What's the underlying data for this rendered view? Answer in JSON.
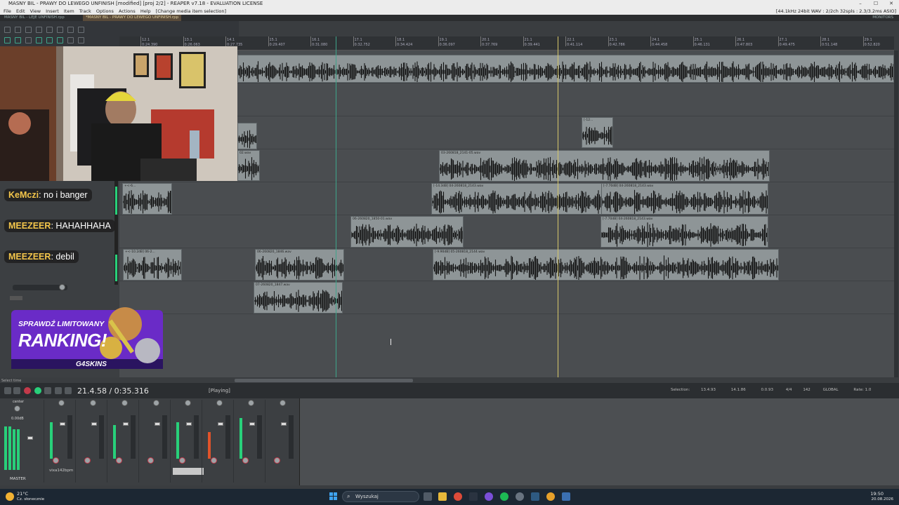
{
  "window": {
    "title": "MASNY BIL - PRAWY DO LEWEGO UNFINISH [modified] [proj 2/2] - REAPER v7.18 - EVALUATION LICENSE",
    "controls": [
      "–",
      "☐",
      "✕"
    ]
  },
  "menu": {
    "items": [
      "File",
      "Edit",
      "View",
      "Insert",
      "Item",
      "Track",
      "Options",
      "Actions",
      "Help"
    ],
    "hint": "[Change media item selection]",
    "audio_status": "[44.1kHz 24bit WAV : 2/2ch 32spls : 2.3/3.2ms ASIO]"
  },
  "tabs": [
    {
      "label": "MASNY BIL - LEJE UNFINISH.rpp"
    },
    {
      "label": "*MASNY BIL - PRAWY DO LEWEGO UNFINISH.rpp"
    }
  ],
  "monitoring": "MONITORS",
  "ruler": {
    "markers": [
      {
        "bar": "12.1",
        "time": "0:24.390"
      },
      {
        "bar": "13.1",
        "time": "0:26.063"
      },
      {
        "bar": "14.1",
        "time": "0:27.735"
      },
      {
        "bar": "15.1",
        "time": "0:29.407"
      },
      {
        "bar": "16.1",
        "time": "0:31.080"
      },
      {
        "bar": "17.1",
        "time": "0:32.752"
      },
      {
        "bar": "18.1",
        "time": "0:34.424"
      },
      {
        "bar": "19.1",
        "time": "0:36.097"
      },
      {
        "bar": "20.1",
        "time": "0:37.769"
      },
      {
        "bar": "21.1",
        "time": "0:39.441"
      },
      {
        "bar": "22.1",
        "time": "0:41.114"
      },
      {
        "bar": "23.1",
        "time": "0:42.786"
      },
      {
        "bar": "24.1",
        "time": "0:44.458"
      },
      {
        "bar": "25.1",
        "time": "0:46.131"
      },
      {
        "bar": "26.1",
        "time": "0:47.803"
      },
      {
        "bar": "27.1",
        "time": "0:49.475"
      },
      {
        "bar": "28.1",
        "time": "0:51.148"
      },
      {
        "bar": "29.1",
        "time": "0:52.820"
      }
    ]
  },
  "items": [
    {
      "label": "[-12..."
    },
    {
      "label": "02.wav"
    },
    {
      "label": "03-260818_2141-05.wav"
    },
    {
      "label": "+<-6..."
    },
    {
      "label": "[-14.3dB] 04-260818_2143.wav"
    },
    {
      "label": "[-7.70dB] 04-260818_2143.wav"
    },
    {
      "label": "06-260820_1850-01.wav"
    },
    {
      "label": "[-7.70dB] 04-260818_2143.wav"
    },
    {
      "label": "+<-10.2dB] 06-2..."
    },
    {
      "label": "06-260820_1846.wav"
    },
    {
      "label": "[-9.90dB] 05-260818_2144.wav"
    },
    {
      "label": "07-260820_1847.wav"
    }
  ],
  "chat": [
    {
      "user": "KeMczi",
      "message": "no i banger"
    },
    {
      "user": "MEEZEER",
      "message": "HAHAHHAHA"
    },
    {
      "user": "MEEZEER",
      "message": "debil"
    }
  ],
  "promo": {
    "line1": "SPRAWDŹ LIMITOWANY",
    "line2": "RANKING!",
    "brand": "G4SKINS"
  },
  "transport": {
    "status_left": "Select time",
    "position": "21.4.58 / 0:35.316",
    "state": "[Playing]"
  },
  "selection": {
    "label": "Selection:",
    "start": "13.4.93",
    "end": "14.1.86",
    "length": "0.0.93",
    "time_sig": "4/4",
    "bpm": "142",
    "rate_label": "Rate:",
    "rate": "1.0",
    "global": "GLOBAL"
  },
  "mixer": {
    "master_label": "MASTER",
    "master_db": "0.00dB",
    "center": "center",
    "track_name": "vixa142bpm",
    "db_values": [
      "+6.0",
      "+6.0",
      "+6.0",
      "+6.0",
      "+6.0",
      "+6.0"
    ]
  },
  "taskbar": {
    "weather_temp": "21°C",
    "weather_desc": "Cz. słonecznie",
    "search_placeholder": "Wyszukaj",
    "time": "19:50",
    "date": "20.08.2026"
  }
}
